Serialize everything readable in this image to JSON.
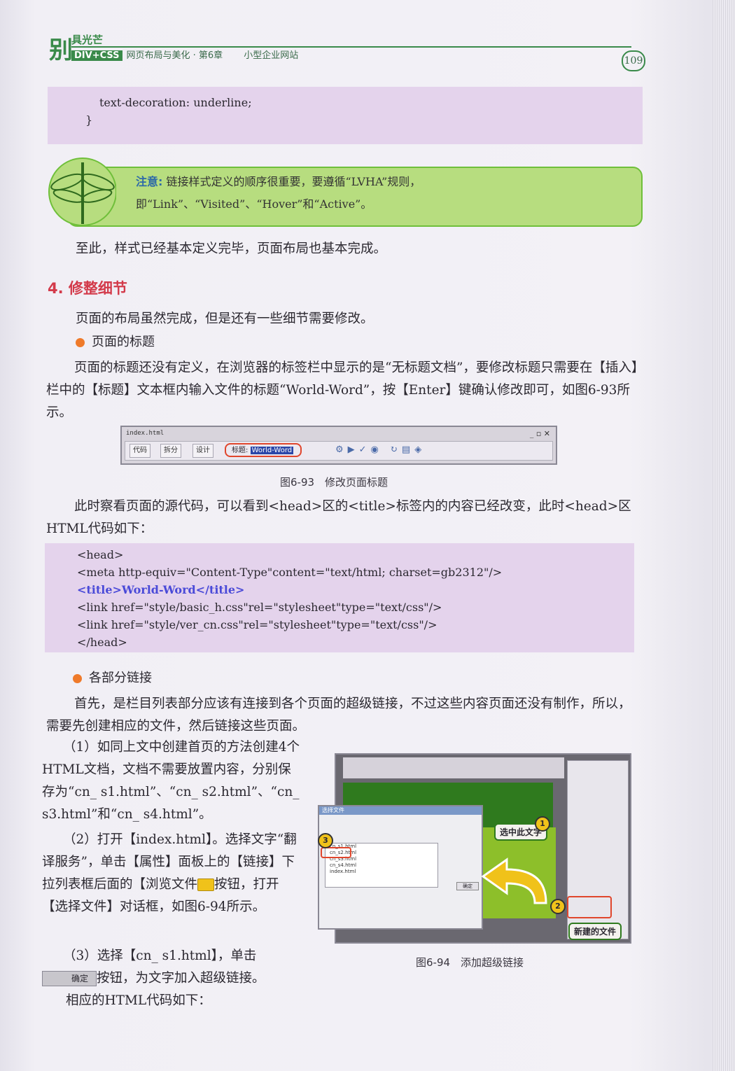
{
  "header": {
    "logo": "别",
    "brand": "具光芒",
    "series": "DIV+CSS",
    "book": "网页布局与美化 · 第6章",
    "chapter": "小型企业网站",
    "page_number": "109"
  },
  "code1": {
    "line1": "text-decoration: underline;",
    "line2": "}"
  },
  "note": {
    "label": "注意:",
    "text": "链接样式定义的顺序很重要，要遵循“LVHA”规则，即“Link”、“Visited”、“Hover”和“Active”。"
  },
  "para_done": "至此，样式已经基本定义完毕，页面布局也基本完成。",
  "section4": {
    "title": "4. 修整细节",
    "intro": "页面的布局虽然完成，但是还有一些细节需要修改。",
    "bullet1": "页面的标题",
    "para1": "页面的标题还没有定义，在浏览器的标签栏中显示的是“无标题文档”，要修改标题只需要在【插入】栏中的【标题】文本框内输入文件的标题“World-Word”，按【Enter】键确认修改即可，如图6-93所示。"
  },
  "fig93": {
    "tab": "index.html",
    "btn_code": "代码",
    "btn_split": "拆分",
    "btn_design": "设计",
    "title_label": "标题:",
    "title_value": "World-Word",
    "caption": "图6-93　修改页面标题"
  },
  "para_head": "此时察看页面的源代码，可以看到<head>区的<title>标签内的内容已经改变，此时<head>区HTML代码如下：",
  "code2": {
    "l1": "<head>",
    "l2": "<meta http-equiv=\"Content-Type\"content=\"text/html; charset=gb2312\"/>",
    "l3": "<title>World-Word</title>",
    "l4": "<link href=\"style/basic_h.css\"rel=\"stylesheet\"type=\"text/css\"/>",
    "l5": "<link href=\"style/ver_cn.css\"rel=\"stylesheet\"type=\"text/css\"/>",
    "l6": "</head>"
  },
  "bullet2": "各部分链接",
  "para_links": "首先，是栏目列表部分应该有连接到各个页面的超级链接，不过这些内容页面还没有制作，所以，需要先创建相应的文件，然后链接这些页面。",
  "step1": "（1）如同上文中创建首页的方法创建4个HTML文档，文档不需要放置内容，分别保存为“cn_ s1.html”、“cn_ s2.html”、“cn_ s3.html”和“cn_ s4.html”。",
  "step2_a": "（2）打开【index.html】。选择文字“翻译服务”，单击【属性】面板上的【链接】下拉列表框后面的【浏览文件",
  "step2_b": "按钮，打开【选择文件】对话框，如图6-94所示。",
  "step3_a": "（3）选择【cn_ s1.html】，单击",
  "step3_ok": "确定",
  "step3_b": "按钮，为文字加入超级链接。",
  "para_last": "相应的HTML代码如下：",
  "fig94": {
    "callout1": "选中此文字",
    "callout2": "新建的文件",
    "n1": "1",
    "n2": "2",
    "n3": "3",
    "dialog_title": "选择文件",
    "files": [
      "cn_s1.html",
      "cn_s2.html",
      "cn_s3.html",
      "cn_s4.html",
      "index.html"
    ],
    "ok": "确定",
    "caption": "图6-94　添加超级链接"
  }
}
